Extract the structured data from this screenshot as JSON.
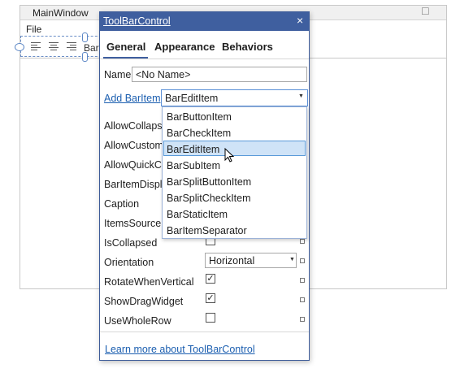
{
  "window": {
    "title": "MainWindow",
    "menu_file": "File",
    "bar_text": "Bar"
  },
  "panel": {
    "title": "ToolBarControl",
    "close_glyph": "×",
    "tabs": [
      "General",
      "Appearance",
      "Behaviors"
    ],
    "active_tab": "General",
    "name_label": "Name",
    "name_value": "<No Name>",
    "add_baritem_label": "Add BarItem",
    "baritem_selected": "BarEditItem",
    "properties": [
      {
        "label": "AllowCollapse"
      },
      {
        "label": "AllowCustom"
      },
      {
        "label": "AllowQuickCu"
      },
      {
        "label": "BarItemDispla"
      },
      {
        "label": "Caption"
      },
      {
        "label": "ItemsSource"
      },
      {
        "label": "IsCollapsed",
        "checked": false
      },
      {
        "label": "Orientation",
        "value": "Horizontal"
      },
      {
        "label": "RotateWhenVertical",
        "checked": true
      },
      {
        "label": "ShowDragWidget",
        "checked": true
      },
      {
        "label": "UseWholeRow",
        "checked": false
      }
    ],
    "learn_more": "Learn more about ToolBarControl"
  },
  "dropdown": {
    "options": [
      "BarButtonItem",
      "BarCheckItem",
      "BarEditItem",
      "BarSubItem",
      "BarSplitButtonItem",
      "BarSplitCheckItem",
      "BarStaticItem",
      "BarItemSeparator"
    ],
    "highlighted": "BarEditItem"
  },
  "colors": {
    "header": "#3f5f9f",
    "link": "#1c5fb0",
    "highlight": "#cfe3f7"
  },
  "icons": [
    "close-icon",
    "dropdown-arrow-icon",
    "eye-icon",
    "align-left-icon",
    "align-center-icon",
    "align-right-icon",
    "mouse-cursor-icon"
  ]
}
